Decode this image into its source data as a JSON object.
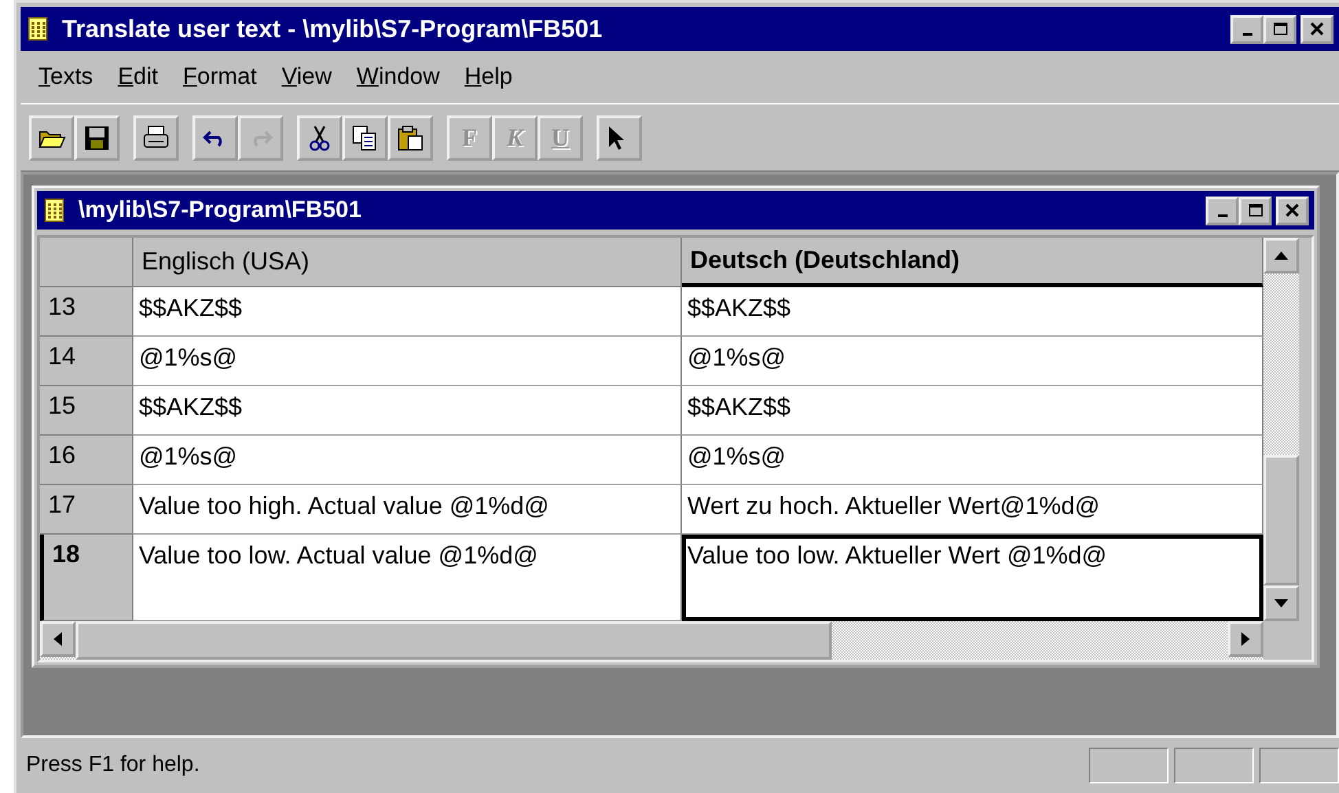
{
  "window": {
    "title": "Translate user text - \\mylib\\S7-Program\\FB501"
  },
  "menu": [
    {
      "key": "T",
      "rest": "exts"
    },
    {
      "key": "E",
      "rest": "dit"
    },
    {
      "key": "F",
      "rest": "ormat"
    },
    {
      "key": "V",
      "rest": "iew"
    },
    {
      "key": "W",
      "rest": "indow"
    },
    {
      "key": "H",
      "rest": "elp"
    }
  ],
  "toolbar": [
    [
      {
        "kind": "open",
        "disabled": false
      },
      {
        "kind": "save",
        "disabled": false
      }
    ],
    [
      {
        "kind": "print",
        "disabled": false
      }
    ],
    [
      {
        "kind": "undo",
        "disabled": false
      },
      {
        "kind": "redo",
        "disabled": true
      }
    ],
    [
      {
        "kind": "cut",
        "disabled": false
      },
      {
        "kind": "copy",
        "disabled": false
      },
      {
        "kind": "paste",
        "disabled": false
      }
    ],
    [
      {
        "kind": "bold",
        "label": "F",
        "disabled": true
      },
      {
        "kind": "italic",
        "label": "K",
        "disabled": true
      },
      {
        "kind": "underline",
        "label": "U",
        "disabled": true
      }
    ],
    [
      {
        "kind": "help",
        "disabled": false
      }
    ]
  ],
  "document": {
    "title": "\\mylib\\S7-Program\\FB501",
    "columns": [
      {
        "label": "Englisch (USA)",
        "selected": false
      },
      {
        "label": "Deutsch (Deutschland)",
        "selected": true
      }
    ],
    "rows": [
      {
        "number": "13",
        "cells": [
          {
            "text": "$$AKZ$$",
            "focused": false
          },
          {
            "text": "$$AKZ$$",
            "focused": false
          }
        ],
        "selected": false
      },
      {
        "number": "14",
        "cells": [
          {
            "text": "@1%s@",
            "focused": false
          },
          {
            "text": "@1%s@",
            "focused": false
          }
        ],
        "selected": false
      },
      {
        "number": "15",
        "cells": [
          {
            "text": "$$AKZ$$",
            "focused": false
          },
          {
            "text": "$$AKZ$$",
            "focused": false
          }
        ],
        "selected": false
      },
      {
        "number": "16",
        "cells": [
          {
            "text": "@1%s@",
            "focused": false
          },
          {
            "text": "@1%s@",
            "focused": false
          }
        ],
        "selected": false
      },
      {
        "number": "17",
        "cells": [
          {
            "text": "Value too high. Actual value @1%d@",
            "focused": false
          },
          {
            "text": "Wert zu hoch. Aktueller Wert@1%d@",
            "focused": false
          }
        ],
        "selected": false
      },
      {
        "number": "18",
        "cells": [
          {
            "text": "Value too low. Actual value @1%d@",
            "focused": false
          },
          {
            "text": "Value too low. Aktueller Wert @1%d@",
            "focused": true
          }
        ],
        "selected": true
      }
    ]
  },
  "status_bar": {
    "text": "Press F1 for help."
  }
}
